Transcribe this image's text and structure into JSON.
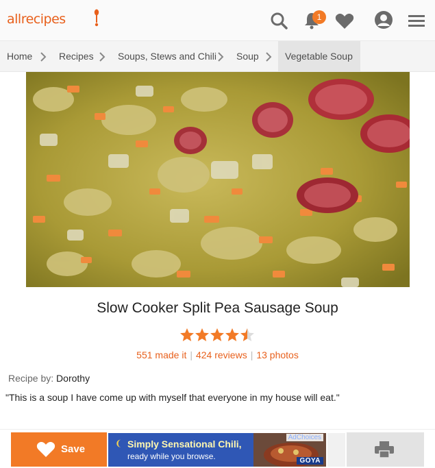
{
  "header": {
    "logo_text": "allrecipes",
    "notification_count": "1",
    "icons": [
      "search-icon",
      "bell-icon",
      "heart-icon",
      "user-icon",
      "menu-icon"
    ]
  },
  "breadcrumb": {
    "items": [
      "Home",
      "Recipes",
      "Soups, Stews and Chili",
      "Soup",
      "Vegetable Soup"
    ]
  },
  "recipe": {
    "title": "Slow Cooker Split Pea Sausage Soup",
    "rating": 4.5,
    "made_it": "551 made it",
    "reviews": "424 reviews",
    "photos": "13 photos",
    "byline_label": "Recipe by:",
    "author": "Dorothy",
    "description": "\"This is a soup I have come up with myself that everyone in my house will eat.\""
  },
  "actions": {
    "save_label": "Save"
  },
  "ad": {
    "line1": "Simply Sensational Chili,",
    "line2": "ready while you browse.",
    "adchoices": "AdChoices",
    "brand": "GOYA"
  },
  "colors": {
    "brand": "#e8601c",
    "save_button": "#f27a26",
    "star": "#f27a26",
    "ad_background": "#2f57b5"
  }
}
